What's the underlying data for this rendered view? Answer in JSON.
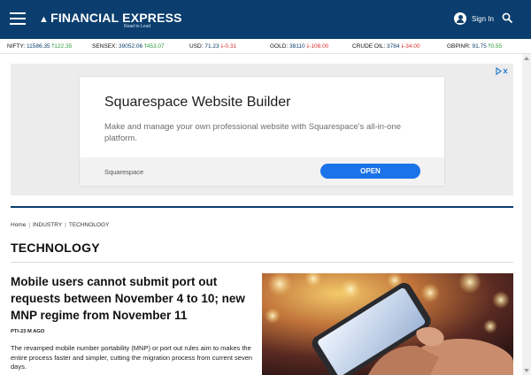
{
  "header": {
    "logo_text": "FINANCIAL EXPRESS",
    "logo_tagline": "Read to Lead",
    "signin_label": "Sign In"
  },
  "ticker": [
    {
      "name": "NIFTY:",
      "value": "11586.35",
      "change": "122.35",
      "direction": "up"
    },
    {
      "name": "SENSEX:",
      "value": "39052.06",
      "change": "453.07",
      "direction": "up"
    },
    {
      "name": "USD:",
      "value": "71.23",
      "change": "-0.31",
      "direction": "down"
    },
    {
      "name": "GOLD:",
      "value": "38110",
      "change": "-108.00",
      "direction": "down"
    },
    {
      "name": "CRUDE OIL:",
      "value": "3784",
      "change": "-34.00",
      "direction": "down"
    },
    {
      "name": "GBPINR:",
      "value": "91.75",
      "change": "0.55",
      "direction": "up"
    }
  ],
  "ad": {
    "title": "Squarespace Website Builder",
    "description": "Make and manage your own professional website with Squarespace's all-in-one platform.",
    "brand": "Squarespace",
    "cta": "OPEN"
  },
  "breadcrumb": [
    "Home",
    "INDUSTRY",
    "TECHNOLOGY"
  ],
  "section_title": "TECHNOLOGY",
  "article": {
    "headline": "Mobile users cannot submit port out requests between November 4 to 10; new MNP regime from November 11",
    "byline": "PTI-23 M AGO",
    "summary": "The revamped mobile number portability (MNP) or port out rules aim to makes the entire process faster and simpler, cutting the migration process from current seven days."
  },
  "colors": {
    "brand_navy": "#0b3e6e",
    "up_green": "#2a9a3a",
    "down_red": "#d9302c",
    "ad_button_blue": "#1a73e8"
  }
}
